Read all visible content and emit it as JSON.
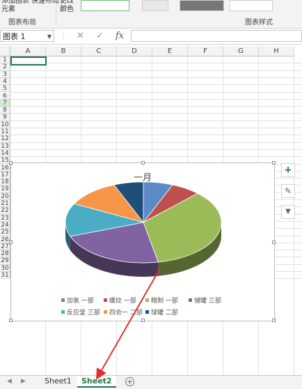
{
  "ribbon": {
    "left_btn": "添加图表 快速布局",
    "left_btn_sub": "元素",
    "color_btn": "更改",
    "color_btn_sub": "颜色",
    "group_layout": "图表布局",
    "group_style": "图表样式"
  },
  "formula_bar": {
    "name_box": "图表 1",
    "cancel": "✕",
    "confirm": "✓",
    "fx": "fx"
  },
  "grid": {
    "columns": [
      "A",
      "B",
      "C",
      "D",
      "E",
      "F",
      "G",
      "H"
    ],
    "rows": [
      "1",
      "2",
      "3",
      "4",
      "5",
      "6",
      "7",
      "8",
      "9",
      "10",
      "11",
      "12",
      "13",
      "14",
      "15",
      "16",
      "17",
      "18",
      "19",
      "20",
      "21",
      "22",
      "23",
      "24",
      "25",
      "26",
      "27",
      "28",
      "29",
      "30",
      "31"
    ],
    "selected_row": "7"
  },
  "chart": {
    "title": "一月",
    "legend": [
      "加氢 一部",
      "螺纹 一部",
      "精制 一部",
      "储罐 三部",
      "反应釜 三部",
      "四合一 二部",
      "球罐 二部"
    ]
  },
  "chart_data": {
    "type": "pie",
    "title": "一月",
    "categories": [
      "加氢 一部",
      "螺纹 一部",
      "精制 一部",
      "储罐 三部",
      "反应釜 三部",
      "四合一 二部",
      "球罐 二部"
    ],
    "values": [
      6,
      6,
      34,
      22,
      13,
      11,
      6
    ],
    "colors": [
      "#5b8ac9",
      "#c0504d",
      "#9bbb59",
      "#8064a2",
      "#4bacc6",
      "#f79646",
      "#1f4e79"
    ]
  },
  "side_buttons": {
    "add": "+",
    "style": "✎",
    "filter": "▼"
  },
  "tabs": {
    "sheet1": "Sheet1",
    "sheet2": "Sheet2",
    "add": "+"
  }
}
